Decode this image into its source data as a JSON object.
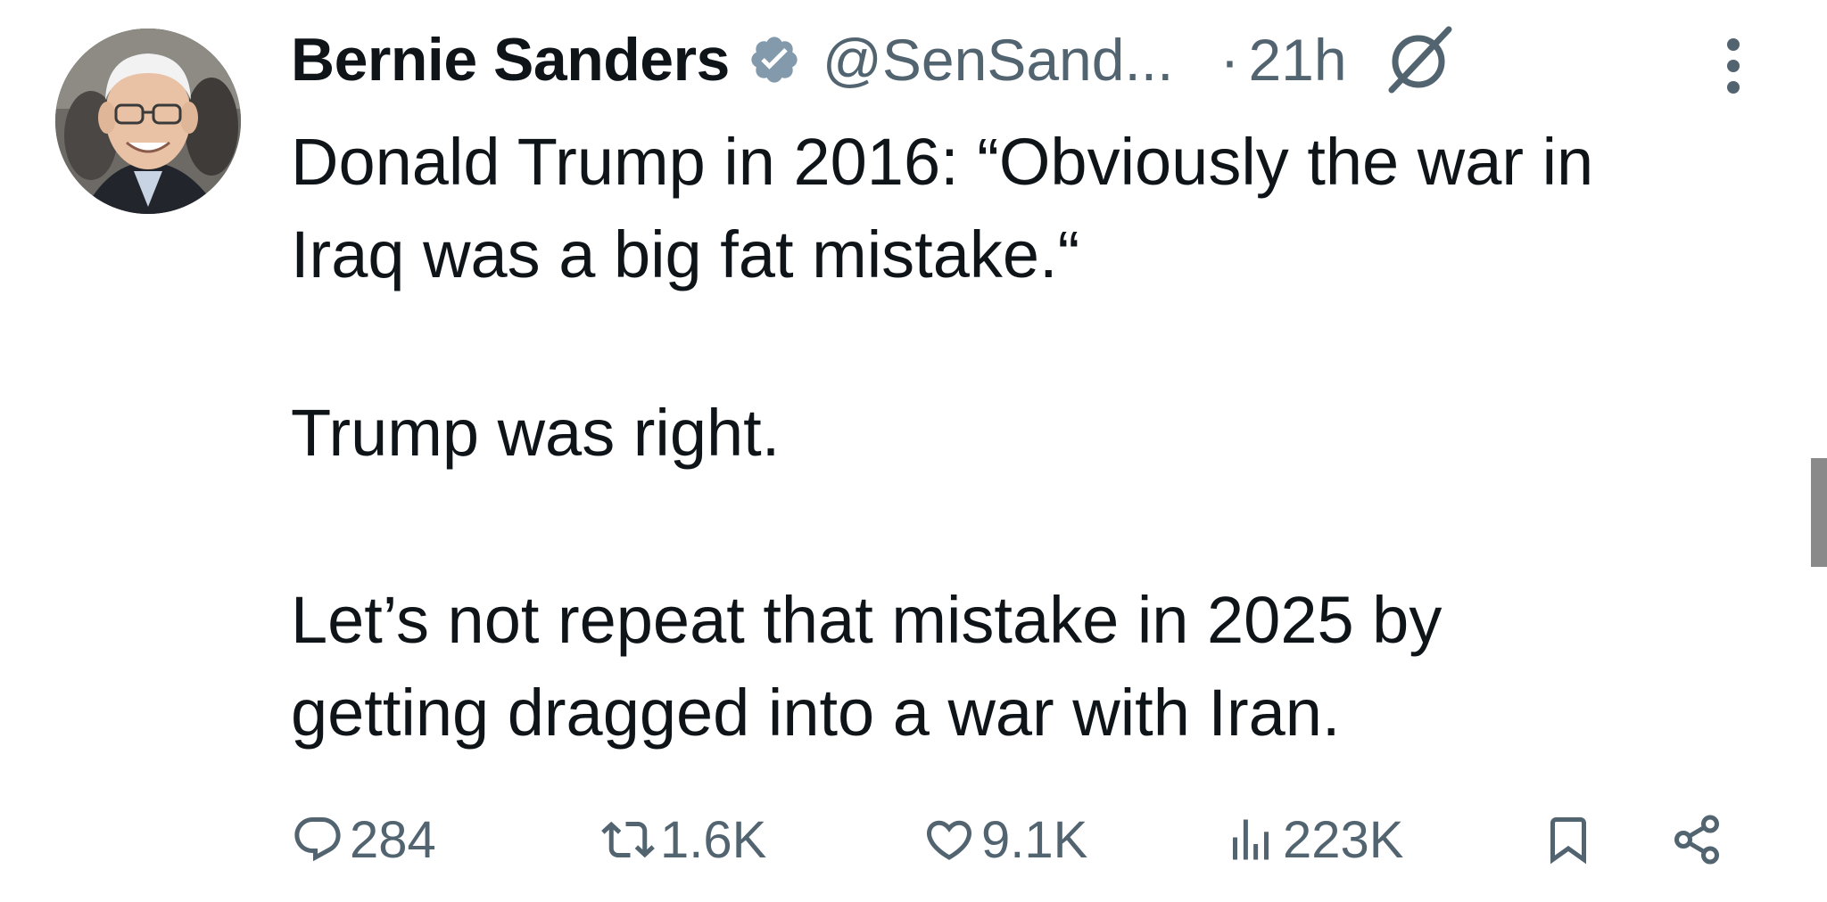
{
  "author": {
    "display_name": "Bernie Sanders",
    "handle": "@SenSand...",
    "separator": "·",
    "time": "21h"
  },
  "tweet": {
    "line1": "Donald Trump in 2016: “Obviously the war in",
    "line2": "Iraq was a big fat mistake.“",
    "para2": "Trump was right.",
    "para3_line1": "Let’s not repeat that mistake in 2025 by",
    "para3_line2": "getting dragged into a war with Iran."
  },
  "actions": {
    "replies": "284",
    "reposts": "1.6K",
    "likes": "9.1K",
    "views": "223K"
  },
  "icons": {
    "verified": "verified-badge-icon",
    "grok": "grok-icon",
    "more": "more-vertical-icon",
    "reply": "reply-icon",
    "repost": "repost-icon",
    "like": "heart-icon",
    "views": "views-chart-icon",
    "bookmark": "bookmark-icon",
    "share": "share-icon"
  },
  "colors": {
    "text": "#0f1419",
    "secondary": "#536471",
    "verified_badge": "#829aab"
  }
}
